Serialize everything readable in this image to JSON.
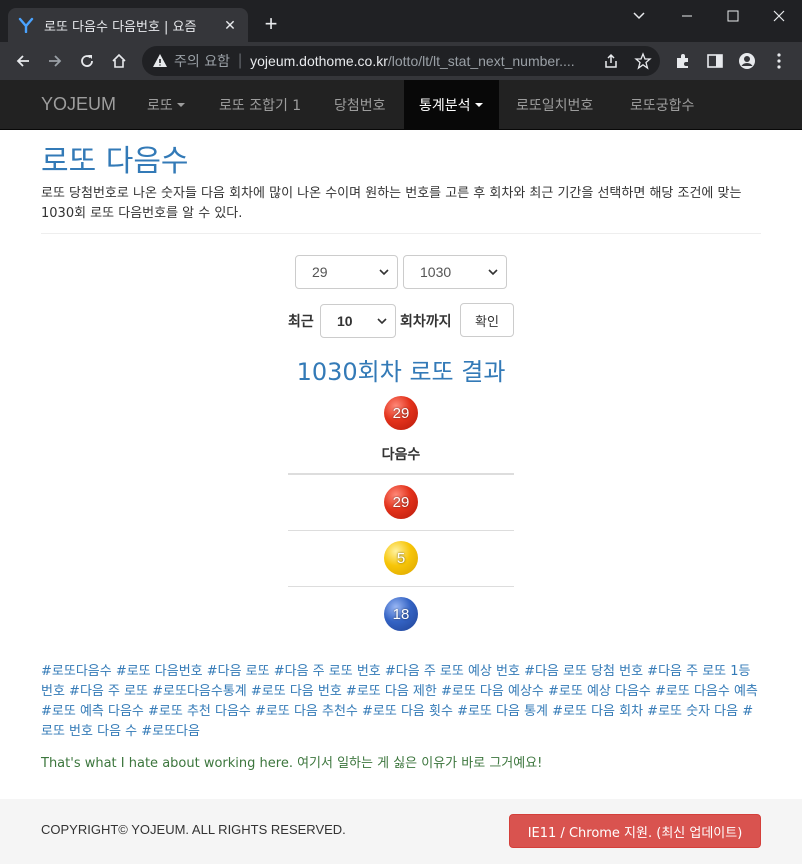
{
  "browser": {
    "tab_title": "로또 다음수 다음번호 | 요즘",
    "security_label": "주의 요함",
    "url_host": "yojeum.dothome.co.kr",
    "url_path": "/lotto/lt/lt_stat_next_number...."
  },
  "navbar": {
    "brand": "YOJEUM",
    "items": [
      {
        "label": "로또",
        "dropdown": true
      },
      {
        "label": "로또 조합기 1"
      },
      {
        "label": "당첨번호"
      },
      {
        "label": "통계분석",
        "dropdown": true,
        "active": true
      },
      {
        "label": "로또일치번호"
      },
      {
        "label": "로또궁합수"
      }
    ]
  },
  "main": {
    "title": "로또 다음수",
    "description": "로또 당첨번호로 나온 숫자들 다음 회차에 많이 나온 수이며 원하는 번호를 고른 후 회차와 최근 기간을 선택하면 해당 조건에 맞는 1030회 로또 다음번호를 알 수 있다.",
    "form": {
      "number_select": "29",
      "round_select": "1030",
      "recent_label": "최근",
      "recent_select": "10",
      "until_label": "회차까지",
      "confirm_button": "확인"
    },
    "result_title": "1030회차 로또 결과",
    "selected_ball": {
      "number": "29",
      "color": "red"
    },
    "next_header": "다음수",
    "next_numbers": [
      {
        "number": "29",
        "color": "red"
      },
      {
        "number": "5",
        "color": "yellow"
      },
      {
        "number": "18",
        "color": "blue"
      }
    ],
    "tags": "#로또다음수 #로또 다음번호 #다음 로또 #다음 주 로또 번호 #다음 주 로또 예상 번호 #다음 로또 당첨 번호 #다음 주 로또 1등 번호 #다음 주 로또 #로또다음수통계 #로또 다음 번호 #로또 다음 제한 #로또 다음 예상수 #로또 예상 다음수 #로또 다음수 예측 #로또 예측 다음수 #로또 추천 다음수 #로또 다음 추천수 #로또 다음 횟수 #로또 다음 통계 #로또 다음 회차 #로또 숫자 다음 #로또 번호 다음 수 #로또다음",
    "quote": "That's what I hate about working here. 여기서 일하는 게 싫은 이유가 바로 그거예요!"
  },
  "footer": {
    "copyright": "COPYRIGHT© YOJEUM. ALL RIGHTS RESERVED.",
    "ie_button": "IE11 / Chrome 지원. (최신 업데이트)"
  },
  "colors": {
    "link": "#337ab7",
    "navbar_bg": "#222222",
    "danger": "#d9534f",
    "quote": "#3c763d"
  }
}
